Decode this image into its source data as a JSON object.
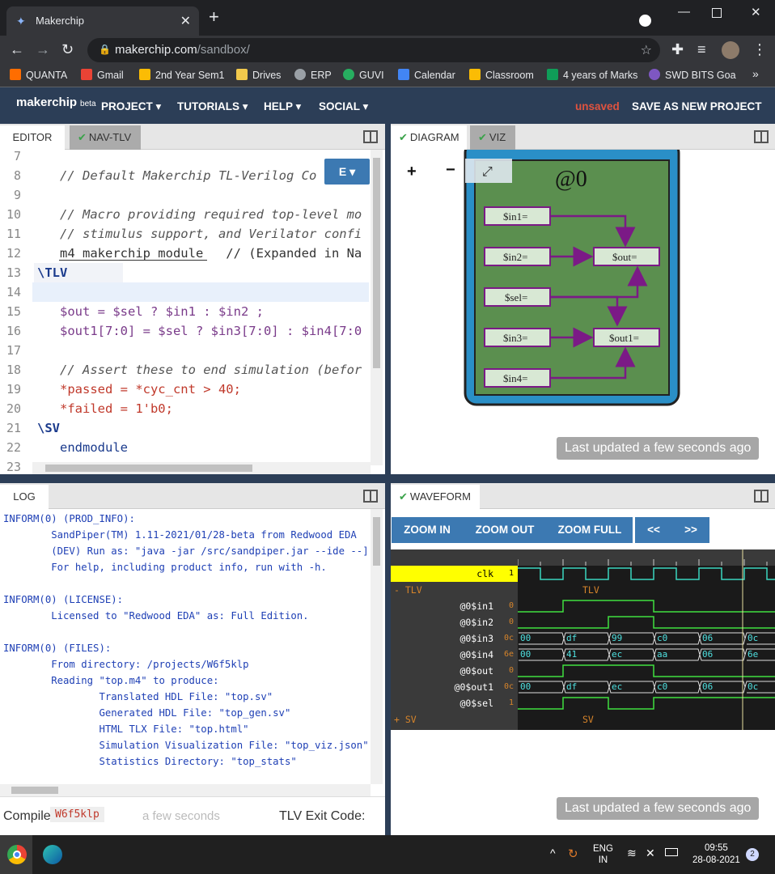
{
  "browser": {
    "tab_title": "Makerchip",
    "tab_close": "✕",
    "new_tab": "+",
    "url_host": "makerchip.com",
    "url_path": "/sandbox/",
    "bookmarks": [
      {
        "label": "QUANTA",
        "color": "#ff6d00"
      },
      {
        "label": "Gmail",
        "color": "#ea4335"
      },
      {
        "label": "2nd Year Sem1",
        "color": "#fbbc04"
      },
      {
        "label": "Drives",
        "color": "#f2c94c"
      },
      {
        "label": "ERP",
        "color": "#9aa0a6"
      },
      {
        "label": "GUVI",
        "color": "#27ae60"
      },
      {
        "label": "Calendar",
        "color": "#4285f4"
      },
      {
        "label": "Classroom",
        "color": "#fbbc04"
      },
      {
        "label": "4 years of Marks",
        "color": "#0f9d58"
      },
      {
        "label": "SWD BITS Goa",
        "color": "#7e57c2"
      }
    ],
    "more_bookmarks": "»"
  },
  "header": {
    "logo": "makerchip",
    "logo_beta": "beta",
    "menus": [
      "PROJECT ▾",
      "TUTORIALS ▾",
      "HELP ▾",
      "SOCIAL ▾"
    ],
    "unsaved": "unsaved",
    "save_as": "SAVE AS NEW PROJECT"
  },
  "editor": {
    "tabs": [
      "EDITOR",
      "NAV-TLV"
    ],
    "e_button": "E ▾",
    "lines": [
      {
        "n": "7",
        "code": ""
      },
      {
        "n": "8",
        "code": "   // Default Makerchip TL-Verilog Co"
      },
      {
        "n": "9",
        "code": ""
      },
      {
        "n": "10",
        "code": "   // Macro providing required top-level mo"
      },
      {
        "n": "11",
        "code": "   // stimulus support, and Verilator confi"
      },
      {
        "n": "12",
        "code": "   m4_makerchip_module   // (Expanded in Na"
      },
      {
        "n": "13",
        "code": "\\TLV"
      },
      {
        "n": "14",
        "code": ""
      },
      {
        "n": "15",
        "code": "   $out = $sel ? $in1 : $in2 ;"
      },
      {
        "n": "16",
        "code": "   $out1[7:0] = $sel ? $in3[7:0] : $in4[7:0"
      },
      {
        "n": "17",
        "code": ""
      },
      {
        "n": "18",
        "code": "   // Assert these to end simulation (befor"
      },
      {
        "n": "19",
        "code": "   *passed = *cyc_cnt > 40;"
      },
      {
        "n": "20",
        "code": "   *failed = 1'b0;"
      },
      {
        "n": "21",
        "code": "\\SV"
      },
      {
        "n": "22",
        "code": "   endmodule"
      },
      {
        "n": "23",
        "code": ""
      }
    ]
  },
  "diagram": {
    "tabs": [
      "DIAGRAM",
      "VIZ"
    ],
    "zoom_in": "+",
    "zoom_out": "−",
    "fit": "⤢",
    "stage": "@0",
    "nodes": [
      "$in1=",
      "$in2=",
      "$sel=",
      "$in3=",
      "$in4=",
      "$out=",
      "$out1="
    ],
    "last_updated": "Last updated a few seconds ago"
  },
  "log": {
    "tab": "LOG",
    "lines": [
      "INFORM(0) (PROD_INFO):",
      "        SandPiper(TM) 1.11-2021/01/28-beta from Redwood EDA",
      "        (DEV) Run as: \"java -jar /src/sandpiper.jar --ide --]",
      "        For help, including product info, run with -h.",
      "",
      "INFORM(0) (LICENSE):",
      "        Licensed to \"Redwood EDA\" as: Full Edition.",
      "",
      "INFORM(0) (FILES):",
      "        From directory: /projects/W6f5klp",
      "        Reading \"top.m4\" to produce:",
      "                Translated HDL File: \"top.sv\"",
      "                Generated HDL File: \"top_gen.sv\"",
      "                HTML TLX File: \"top.html\"",
      "                Simulation Visualization File: \"top_viz.json\"",
      "                Statistics Directory: \"top_stats\""
    ],
    "compile_label": "Compile",
    "compile_id": "W6f5klp",
    "compile_time": "a few seconds",
    "exit_label": "TLV Exit Code:"
  },
  "waveform": {
    "tab": "WAVEFORM",
    "buttons": [
      "ZOOM IN",
      "ZOOM OUT",
      "ZOOM FULL"
    ],
    "nav": [
      "<<",
      ">>"
    ],
    "signals": [
      {
        "name": "clk",
        "val": "1"
      },
      {
        "name": "TLV",
        "val": ""
      },
      {
        "name": "@0$in1",
        "val": "0"
      },
      {
        "name": "@0$in2",
        "val": "0"
      },
      {
        "name": "@0$in3",
        "val": "0c"
      },
      {
        "name": "@0$in4",
        "val": "6e"
      },
      {
        "name": "@0$out",
        "val": "0"
      },
      {
        "name": "@0$out1",
        "val": "0c"
      },
      {
        "name": "@0$sel",
        "val": "1"
      },
      {
        "name": "SV",
        "val": ""
      }
    ],
    "group_tlv": "- TLV",
    "group_sv": "+ SV",
    "scope_tlv": "TLV",
    "scope_sv": "SV",
    "in3_values": [
      "00",
      "df",
      "99",
      "c0",
      "06",
      "0c"
    ],
    "in4_values": [
      "00",
      "41",
      "ec",
      "aa",
      "06",
      "6e"
    ],
    "out1_values": [
      "00",
      "df",
      "ec",
      "c0",
      "06",
      "0c"
    ],
    "last_updated": "Last updated a few seconds ago"
  },
  "taskbar": {
    "lang1": "ENG",
    "lang2": "IN",
    "time": "09:55",
    "date": "28-08-2021",
    "notif": "2"
  }
}
